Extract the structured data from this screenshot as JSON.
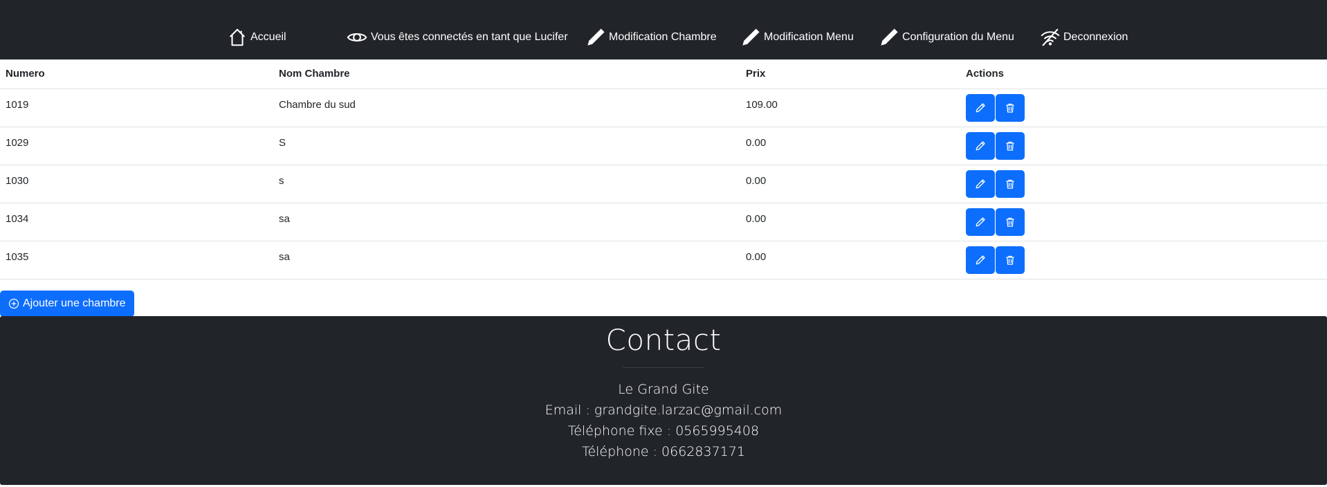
{
  "nav": {
    "home_label": "Accueil",
    "user_label": "Vous êtes connectés en tant que Lucifer",
    "rooms_edit_label": "Modification Chambre",
    "menu_edit_label": "Modification Menu",
    "menu_config_label": "Configuration du Menu",
    "logout_label": "Deconnexion"
  },
  "table": {
    "headers": {
      "numero": "Numero",
      "nom": "Nom Chambre",
      "prix": "Prix",
      "actions": "Actions"
    },
    "rows": [
      {
        "numero": "1019",
        "nom": "Chambre du sud",
        "prix": "109.00"
      },
      {
        "numero": "1029",
        "nom": "S",
        "prix": "0.00"
      },
      {
        "numero": "1030",
        "nom": "s",
        "prix": "0.00"
      },
      {
        "numero": "1034",
        "nom": "sa",
        "prix": "0.00"
      },
      {
        "numero": "1035",
        "nom": "sa",
        "prix": "0.00"
      }
    ]
  },
  "add_button_label": "Ajouter une chambre",
  "footer": {
    "title": "Contact",
    "name": "Le Grand Gite",
    "email": "Email : grandgite.larzac@gmail.com",
    "phone_fixed": "Téléphone fixe : 0565995408",
    "phone": "Téléphone : 0662837171"
  },
  "icons": {
    "home": "house-icon",
    "user": "eye-icon",
    "rooms_edit": "pencil-icon",
    "menu_edit": "pencil-icon",
    "menu_config": "pencil-icon",
    "logout": "wifi-off-icon",
    "edit_row": "pencil-icon",
    "delete_row": "trash-icon",
    "add": "plus-circle-icon"
  },
  "colors": {
    "dark": "#212529",
    "primary": "#0d6efd",
    "border": "#dee2e6"
  }
}
